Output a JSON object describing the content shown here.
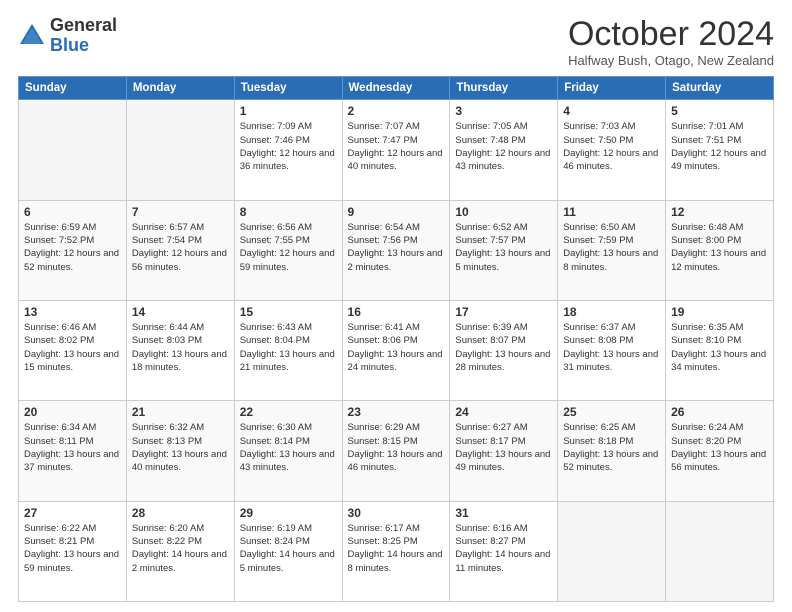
{
  "logo": {
    "general": "General",
    "blue": "Blue"
  },
  "header": {
    "title": "October 2024",
    "subtitle": "Halfway Bush, Otago, New Zealand"
  },
  "weekdays": [
    "Sunday",
    "Monday",
    "Tuesday",
    "Wednesday",
    "Thursday",
    "Friday",
    "Saturday"
  ],
  "weeks": [
    [
      {
        "day": "",
        "empty": true
      },
      {
        "day": "",
        "empty": true
      },
      {
        "day": "1",
        "sunrise": "Sunrise: 7:09 AM",
        "sunset": "Sunset: 7:46 PM",
        "daylight": "Daylight: 12 hours and 36 minutes."
      },
      {
        "day": "2",
        "sunrise": "Sunrise: 7:07 AM",
        "sunset": "Sunset: 7:47 PM",
        "daylight": "Daylight: 12 hours and 40 minutes."
      },
      {
        "day": "3",
        "sunrise": "Sunrise: 7:05 AM",
        "sunset": "Sunset: 7:48 PM",
        "daylight": "Daylight: 12 hours and 43 minutes."
      },
      {
        "day": "4",
        "sunrise": "Sunrise: 7:03 AM",
        "sunset": "Sunset: 7:50 PM",
        "daylight": "Daylight: 12 hours and 46 minutes."
      },
      {
        "day": "5",
        "sunrise": "Sunrise: 7:01 AM",
        "sunset": "Sunset: 7:51 PM",
        "daylight": "Daylight: 12 hours and 49 minutes."
      }
    ],
    [
      {
        "day": "6",
        "sunrise": "Sunrise: 6:59 AM",
        "sunset": "Sunset: 7:52 PM",
        "daylight": "Daylight: 12 hours and 52 minutes."
      },
      {
        "day": "7",
        "sunrise": "Sunrise: 6:57 AM",
        "sunset": "Sunset: 7:54 PM",
        "daylight": "Daylight: 12 hours and 56 minutes."
      },
      {
        "day": "8",
        "sunrise": "Sunrise: 6:56 AM",
        "sunset": "Sunset: 7:55 PM",
        "daylight": "Daylight: 12 hours and 59 minutes."
      },
      {
        "day": "9",
        "sunrise": "Sunrise: 6:54 AM",
        "sunset": "Sunset: 7:56 PM",
        "daylight": "Daylight: 13 hours and 2 minutes."
      },
      {
        "day": "10",
        "sunrise": "Sunrise: 6:52 AM",
        "sunset": "Sunset: 7:57 PM",
        "daylight": "Daylight: 13 hours and 5 minutes."
      },
      {
        "day": "11",
        "sunrise": "Sunrise: 6:50 AM",
        "sunset": "Sunset: 7:59 PM",
        "daylight": "Daylight: 13 hours and 8 minutes."
      },
      {
        "day": "12",
        "sunrise": "Sunrise: 6:48 AM",
        "sunset": "Sunset: 8:00 PM",
        "daylight": "Daylight: 13 hours and 12 minutes."
      }
    ],
    [
      {
        "day": "13",
        "sunrise": "Sunrise: 6:46 AM",
        "sunset": "Sunset: 8:02 PM",
        "daylight": "Daylight: 13 hours and 15 minutes."
      },
      {
        "day": "14",
        "sunrise": "Sunrise: 6:44 AM",
        "sunset": "Sunset: 8:03 PM",
        "daylight": "Daylight: 13 hours and 18 minutes."
      },
      {
        "day": "15",
        "sunrise": "Sunrise: 6:43 AM",
        "sunset": "Sunset: 8:04 PM",
        "daylight": "Daylight: 13 hours and 21 minutes."
      },
      {
        "day": "16",
        "sunrise": "Sunrise: 6:41 AM",
        "sunset": "Sunset: 8:06 PM",
        "daylight": "Daylight: 13 hours and 24 minutes."
      },
      {
        "day": "17",
        "sunrise": "Sunrise: 6:39 AM",
        "sunset": "Sunset: 8:07 PM",
        "daylight": "Daylight: 13 hours and 28 minutes."
      },
      {
        "day": "18",
        "sunrise": "Sunrise: 6:37 AM",
        "sunset": "Sunset: 8:08 PM",
        "daylight": "Daylight: 13 hours and 31 minutes."
      },
      {
        "day": "19",
        "sunrise": "Sunrise: 6:35 AM",
        "sunset": "Sunset: 8:10 PM",
        "daylight": "Daylight: 13 hours and 34 minutes."
      }
    ],
    [
      {
        "day": "20",
        "sunrise": "Sunrise: 6:34 AM",
        "sunset": "Sunset: 8:11 PM",
        "daylight": "Daylight: 13 hours and 37 minutes."
      },
      {
        "day": "21",
        "sunrise": "Sunrise: 6:32 AM",
        "sunset": "Sunset: 8:13 PM",
        "daylight": "Daylight: 13 hours and 40 minutes."
      },
      {
        "day": "22",
        "sunrise": "Sunrise: 6:30 AM",
        "sunset": "Sunset: 8:14 PM",
        "daylight": "Daylight: 13 hours and 43 minutes."
      },
      {
        "day": "23",
        "sunrise": "Sunrise: 6:29 AM",
        "sunset": "Sunset: 8:15 PM",
        "daylight": "Daylight: 13 hours and 46 minutes."
      },
      {
        "day": "24",
        "sunrise": "Sunrise: 6:27 AM",
        "sunset": "Sunset: 8:17 PM",
        "daylight": "Daylight: 13 hours and 49 minutes."
      },
      {
        "day": "25",
        "sunrise": "Sunrise: 6:25 AM",
        "sunset": "Sunset: 8:18 PM",
        "daylight": "Daylight: 13 hours and 52 minutes."
      },
      {
        "day": "26",
        "sunrise": "Sunrise: 6:24 AM",
        "sunset": "Sunset: 8:20 PM",
        "daylight": "Daylight: 13 hours and 56 minutes."
      }
    ],
    [
      {
        "day": "27",
        "sunrise": "Sunrise: 6:22 AM",
        "sunset": "Sunset: 8:21 PM",
        "daylight": "Daylight: 13 hours and 59 minutes."
      },
      {
        "day": "28",
        "sunrise": "Sunrise: 6:20 AM",
        "sunset": "Sunset: 8:22 PM",
        "daylight": "Daylight: 14 hours and 2 minutes."
      },
      {
        "day": "29",
        "sunrise": "Sunrise: 6:19 AM",
        "sunset": "Sunset: 8:24 PM",
        "daylight": "Daylight: 14 hours and 5 minutes."
      },
      {
        "day": "30",
        "sunrise": "Sunrise: 6:17 AM",
        "sunset": "Sunset: 8:25 PM",
        "daylight": "Daylight: 14 hours and 8 minutes."
      },
      {
        "day": "31",
        "sunrise": "Sunrise: 6:16 AM",
        "sunset": "Sunset: 8:27 PM",
        "daylight": "Daylight: 14 hours and 11 minutes."
      },
      {
        "day": "",
        "empty": true
      },
      {
        "day": "",
        "empty": true
      }
    ]
  ]
}
